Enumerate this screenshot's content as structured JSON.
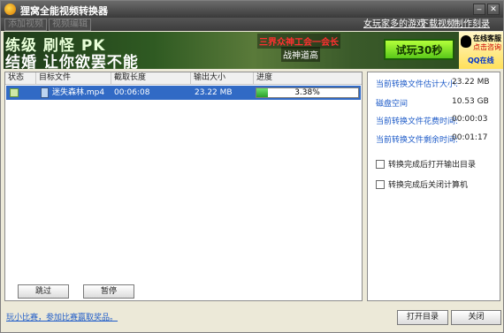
{
  "window": {
    "title": "狸窝全能视频转换器"
  },
  "toolbar": {
    "add_video": "添加视频",
    "video_edit": "视频编辑",
    "links": [
      "女玩家多的游戏",
      "下载视频",
      "制作刻录DVD"
    ]
  },
  "banner": {
    "slogan_line1": "练级 刷怪 PK",
    "slogan_line2": "结婚 让你欲罢不能",
    "mid_line1": "三界众神工会一会长",
    "mid_line2": "战神道高",
    "try_button": "试玩30秒",
    "service_line1": "在线客服",
    "service_line2": "点击咨询",
    "service_line3": "QQ在线"
  },
  "table": {
    "columns": [
      "状态",
      "目标文件",
      "截取长度",
      "输出大小",
      "进度"
    ],
    "rows": [
      {
        "file": "迷失森林.mp4",
        "length": "00:06:08",
        "size": "23.22 MB",
        "progress_text": "3.38%",
        "progress": 0.0338
      }
    ]
  },
  "list_buttons": {
    "skip": "跳过",
    "pause": "暂停"
  },
  "side": {
    "stats": [
      {
        "label": "当前转换文件估计大小:",
        "value": "23.22 MB"
      },
      {
        "label": "磁盘空间",
        "value": "10.53 GB"
      },
      {
        "label": "当前转换文件花费时间:",
        "value": "00:00:03"
      },
      {
        "label": "当前转换文件剩余时间:",
        "value": "00:01:17"
      }
    ],
    "options": [
      {
        "label": "转换完成后打开输出目录",
        "checked": false
      },
      {
        "label": "转换完成后关闭计算机",
        "checked": false
      }
    ]
  },
  "footer": {
    "link": "玩小比赛，参加比赛赢取奖品。",
    "open_dir": "打开目录",
    "close": "关闭"
  },
  "colors": {
    "selected_row": "#316ac5",
    "link": "#1e5bc8",
    "progress_fill": "#2aa02a"
  }
}
